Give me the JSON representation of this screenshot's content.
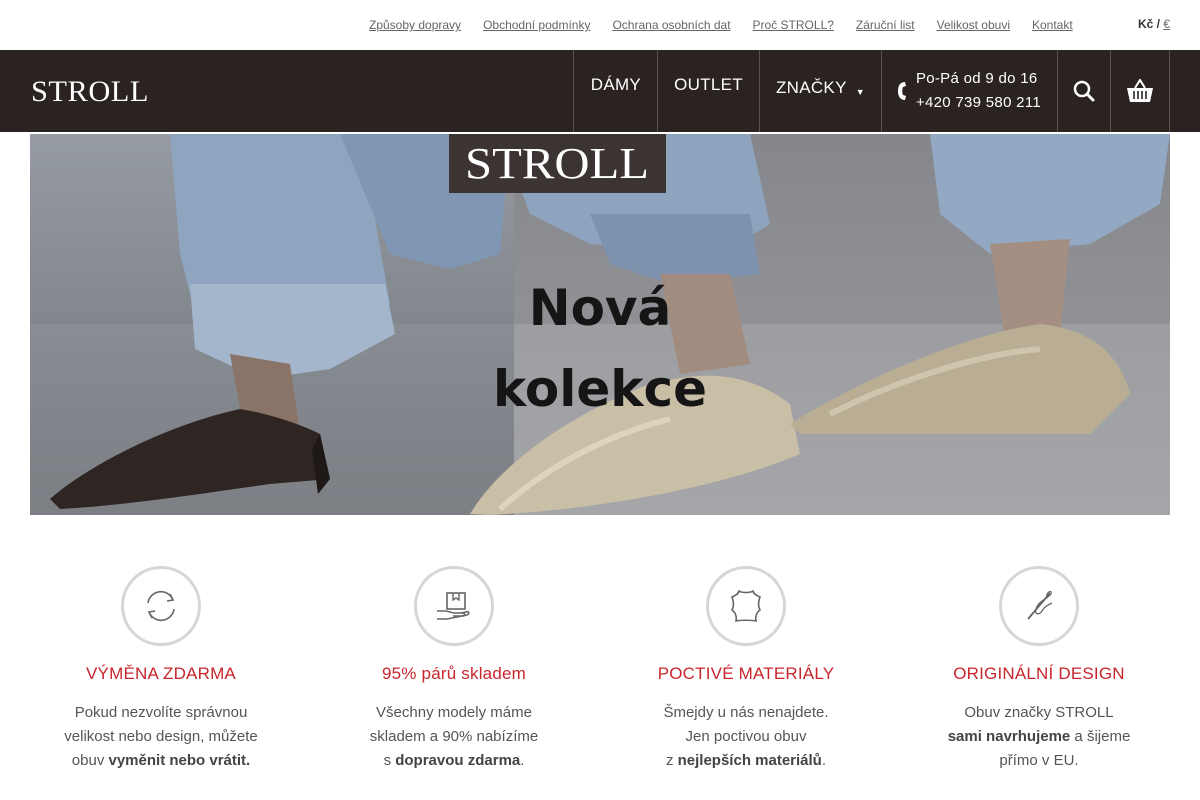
{
  "topbar": {
    "links": [
      "Způsoby dopravy",
      "Obchodní podmínky",
      "Ochrana osobních dat",
      "Proč STROLL?",
      "Záruční list",
      "Velikost obuvi",
      "Kontakt"
    ],
    "currency_active": "Kč",
    "currency_sep": " / ",
    "currency_other": "€"
  },
  "navbar": {
    "logo_text": "STROLL",
    "items": [
      "DÁMY",
      "OUTLET",
      "ZNAČKY"
    ],
    "dropdown_arrow": "▼",
    "phone_hours": "Po-Pá od 9 do 16",
    "phone_number": "+420 739 580 211",
    "icons": [
      "phone-icon",
      "search-icon",
      "basket-icon"
    ]
  },
  "hero": {
    "logo_text": "STROLL",
    "title_line1": "Nová",
    "title_line2": "kolekce"
  },
  "features": [
    {
      "icon": "exchange-arrows-icon",
      "title": "VÝMĚNA ZDARMA",
      "lines": [
        {
          "pre": "Pokud nezvolíte správnou",
          "bold": "",
          "post": ""
        },
        {
          "pre": "velikost nebo design, můžete",
          "bold": "",
          "post": ""
        },
        {
          "pre": "obuv ",
          "bold": "vyměnit nebo vrátit.",
          "post": ""
        }
      ]
    },
    {
      "icon": "boxes-hand-icon",
      "title": "95% párů skladem",
      "lines": [
        {
          "pre": "Všechny modely máme",
          "bold": "",
          "post": ""
        },
        {
          "pre": "skladem a 90% nabízíme",
          "bold": "",
          "post": ""
        },
        {
          "pre": "s ",
          "bold": "dopravou zdarma",
          "post": "."
        }
      ]
    },
    {
      "icon": "leather-hide-icon",
      "title": "POCTIVÉ MATERIÁLY",
      "lines": [
        {
          "pre": "Šmejdy u nás nenajdete.",
          "bold": "",
          "post": ""
        },
        {
          "pre": "Jen poctivou obuv",
          "bold": "",
          "post": ""
        },
        {
          "pre": "z ",
          "bold": "nejlepších materiálů",
          "post": "."
        }
      ]
    },
    {
      "icon": "needle-thread-icon",
      "title": "ORIGINÁLNÍ DESIGN",
      "lines": [
        {
          "pre": "Obuv značky STROLL",
          "bold": "",
          "post": ""
        },
        {
          "pre": "",
          "bold": "sami navrhujeme",
          "post": " a šijeme"
        },
        {
          "pre": "přímo v EU.",
          "bold": "",
          "post": ""
        }
      ]
    }
  ],
  "colors": {
    "nav_bg": "#2a2322",
    "accent_red": "#c9252c",
    "text_gray": "#555555"
  }
}
